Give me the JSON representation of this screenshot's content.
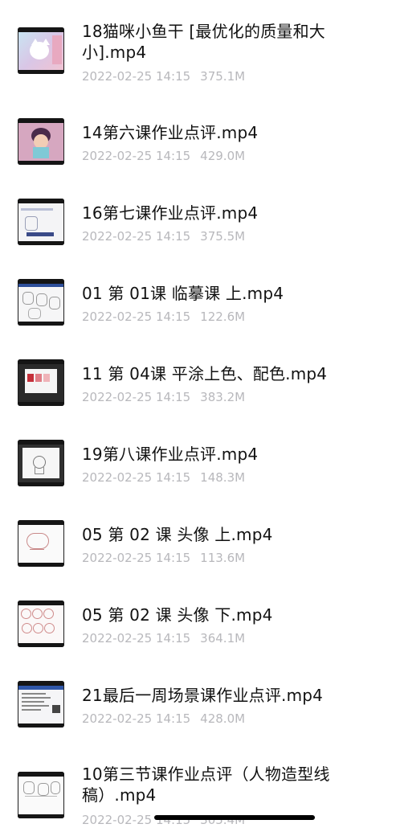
{
  "files": [
    {
      "title": "18猫咪小鱼干 [最优化的质量和大小].mp4",
      "date": "2022-02-25 14:15",
      "size": "375.1M",
      "thumb_icon": "video-thumbnail-cartoon-cat"
    },
    {
      "title": "14第六课作业点评.mp4",
      "date": "2022-02-25 14:15",
      "size": "429.0M",
      "thumb_icon": "video-thumbnail-character-drawing"
    },
    {
      "title": "16第七课作业点评.mp4",
      "date": "2022-02-25 14:15",
      "size": "375.5M",
      "thumb_icon": "video-thumbnail-sketch"
    },
    {
      "title": "01 第 01课 临摹课 上.mp4",
      "date": "2022-02-25 14:15",
      "size": "122.6M",
      "thumb_icon": "video-thumbnail-sketch"
    },
    {
      "title": "11 第 04课 平涂上色、配色.mp4",
      "date": "2022-02-25 14:15",
      "size": "383.2M",
      "thumb_icon": "video-thumbnail-color-swatches"
    },
    {
      "title": "19第八课作业点评.mp4",
      "date": "2022-02-25 14:15",
      "size": "148.3M",
      "thumb_icon": "video-thumbnail-sketch"
    },
    {
      "title": "05 第 02 课 头像 上.mp4",
      "date": "2022-02-25 14:15",
      "size": "113.6M",
      "thumb_icon": "video-thumbnail-sketch"
    },
    {
      "title": "05 第 02 课 头像 下.mp4",
      "date": "2022-02-25 14:15",
      "size": "364.1M",
      "thumb_icon": "video-thumbnail-sketch"
    },
    {
      "title": "21最后一周场景课作业点评.mp4",
      "date": "2022-02-25 14:15",
      "size": "428.0M",
      "thumb_icon": "video-thumbnail-document"
    },
    {
      "title": "10第三节课作业点评（人物造型线稿）.mp4",
      "date": "2022-02-25 14:15",
      "size": "305.4M",
      "thumb_icon": "video-thumbnail-sketch"
    }
  ]
}
